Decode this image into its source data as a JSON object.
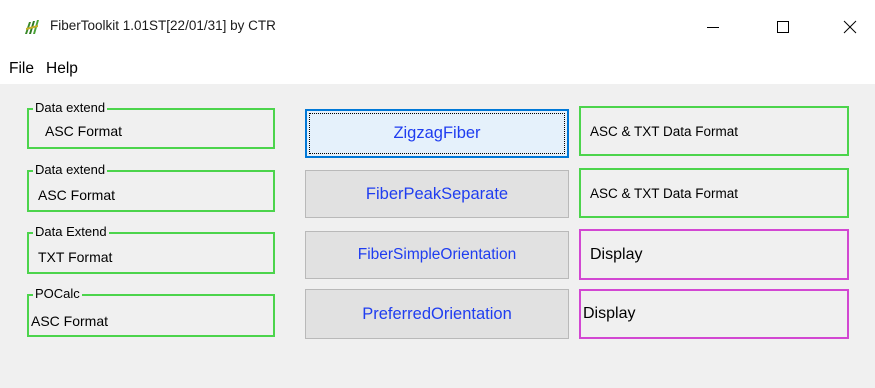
{
  "window": {
    "title": "FiberToolkit 1.01ST[22/01/31] by CTR",
    "icon": "fiber-app-icon",
    "controls": [
      "minimize-icon",
      "maximize-icon",
      "close-icon"
    ]
  },
  "menu": {
    "file": "File",
    "help": "Help"
  },
  "rows": [
    {
      "group_caption": "Data extend",
      "group_text": "ASC  Format",
      "button": "ZigzagFiber",
      "output": "ASC & TXT Data Format"
    },
    {
      "group_caption": "Data extend",
      "group_text": "ASC Format",
      "button": "FiberPeakSeparate",
      "output": "ASC & TXT Data Format"
    },
    {
      "group_caption": "Data Extend",
      "group_text": "TXT Format",
      "button": "FiberSimpleOrientation",
      "output": "Display"
    },
    {
      "group_caption": "POCalc",
      "group_text": "ASC Format",
      "button": "PreferredOrientation",
      "output": "Display"
    }
  ],
  "colors": {
    "group_border": "#4cd44c",
    "display_border": "#d247d2",
    "button_text": "#1f3df0",
    "focus_border": "#0078d7"
  }
}
